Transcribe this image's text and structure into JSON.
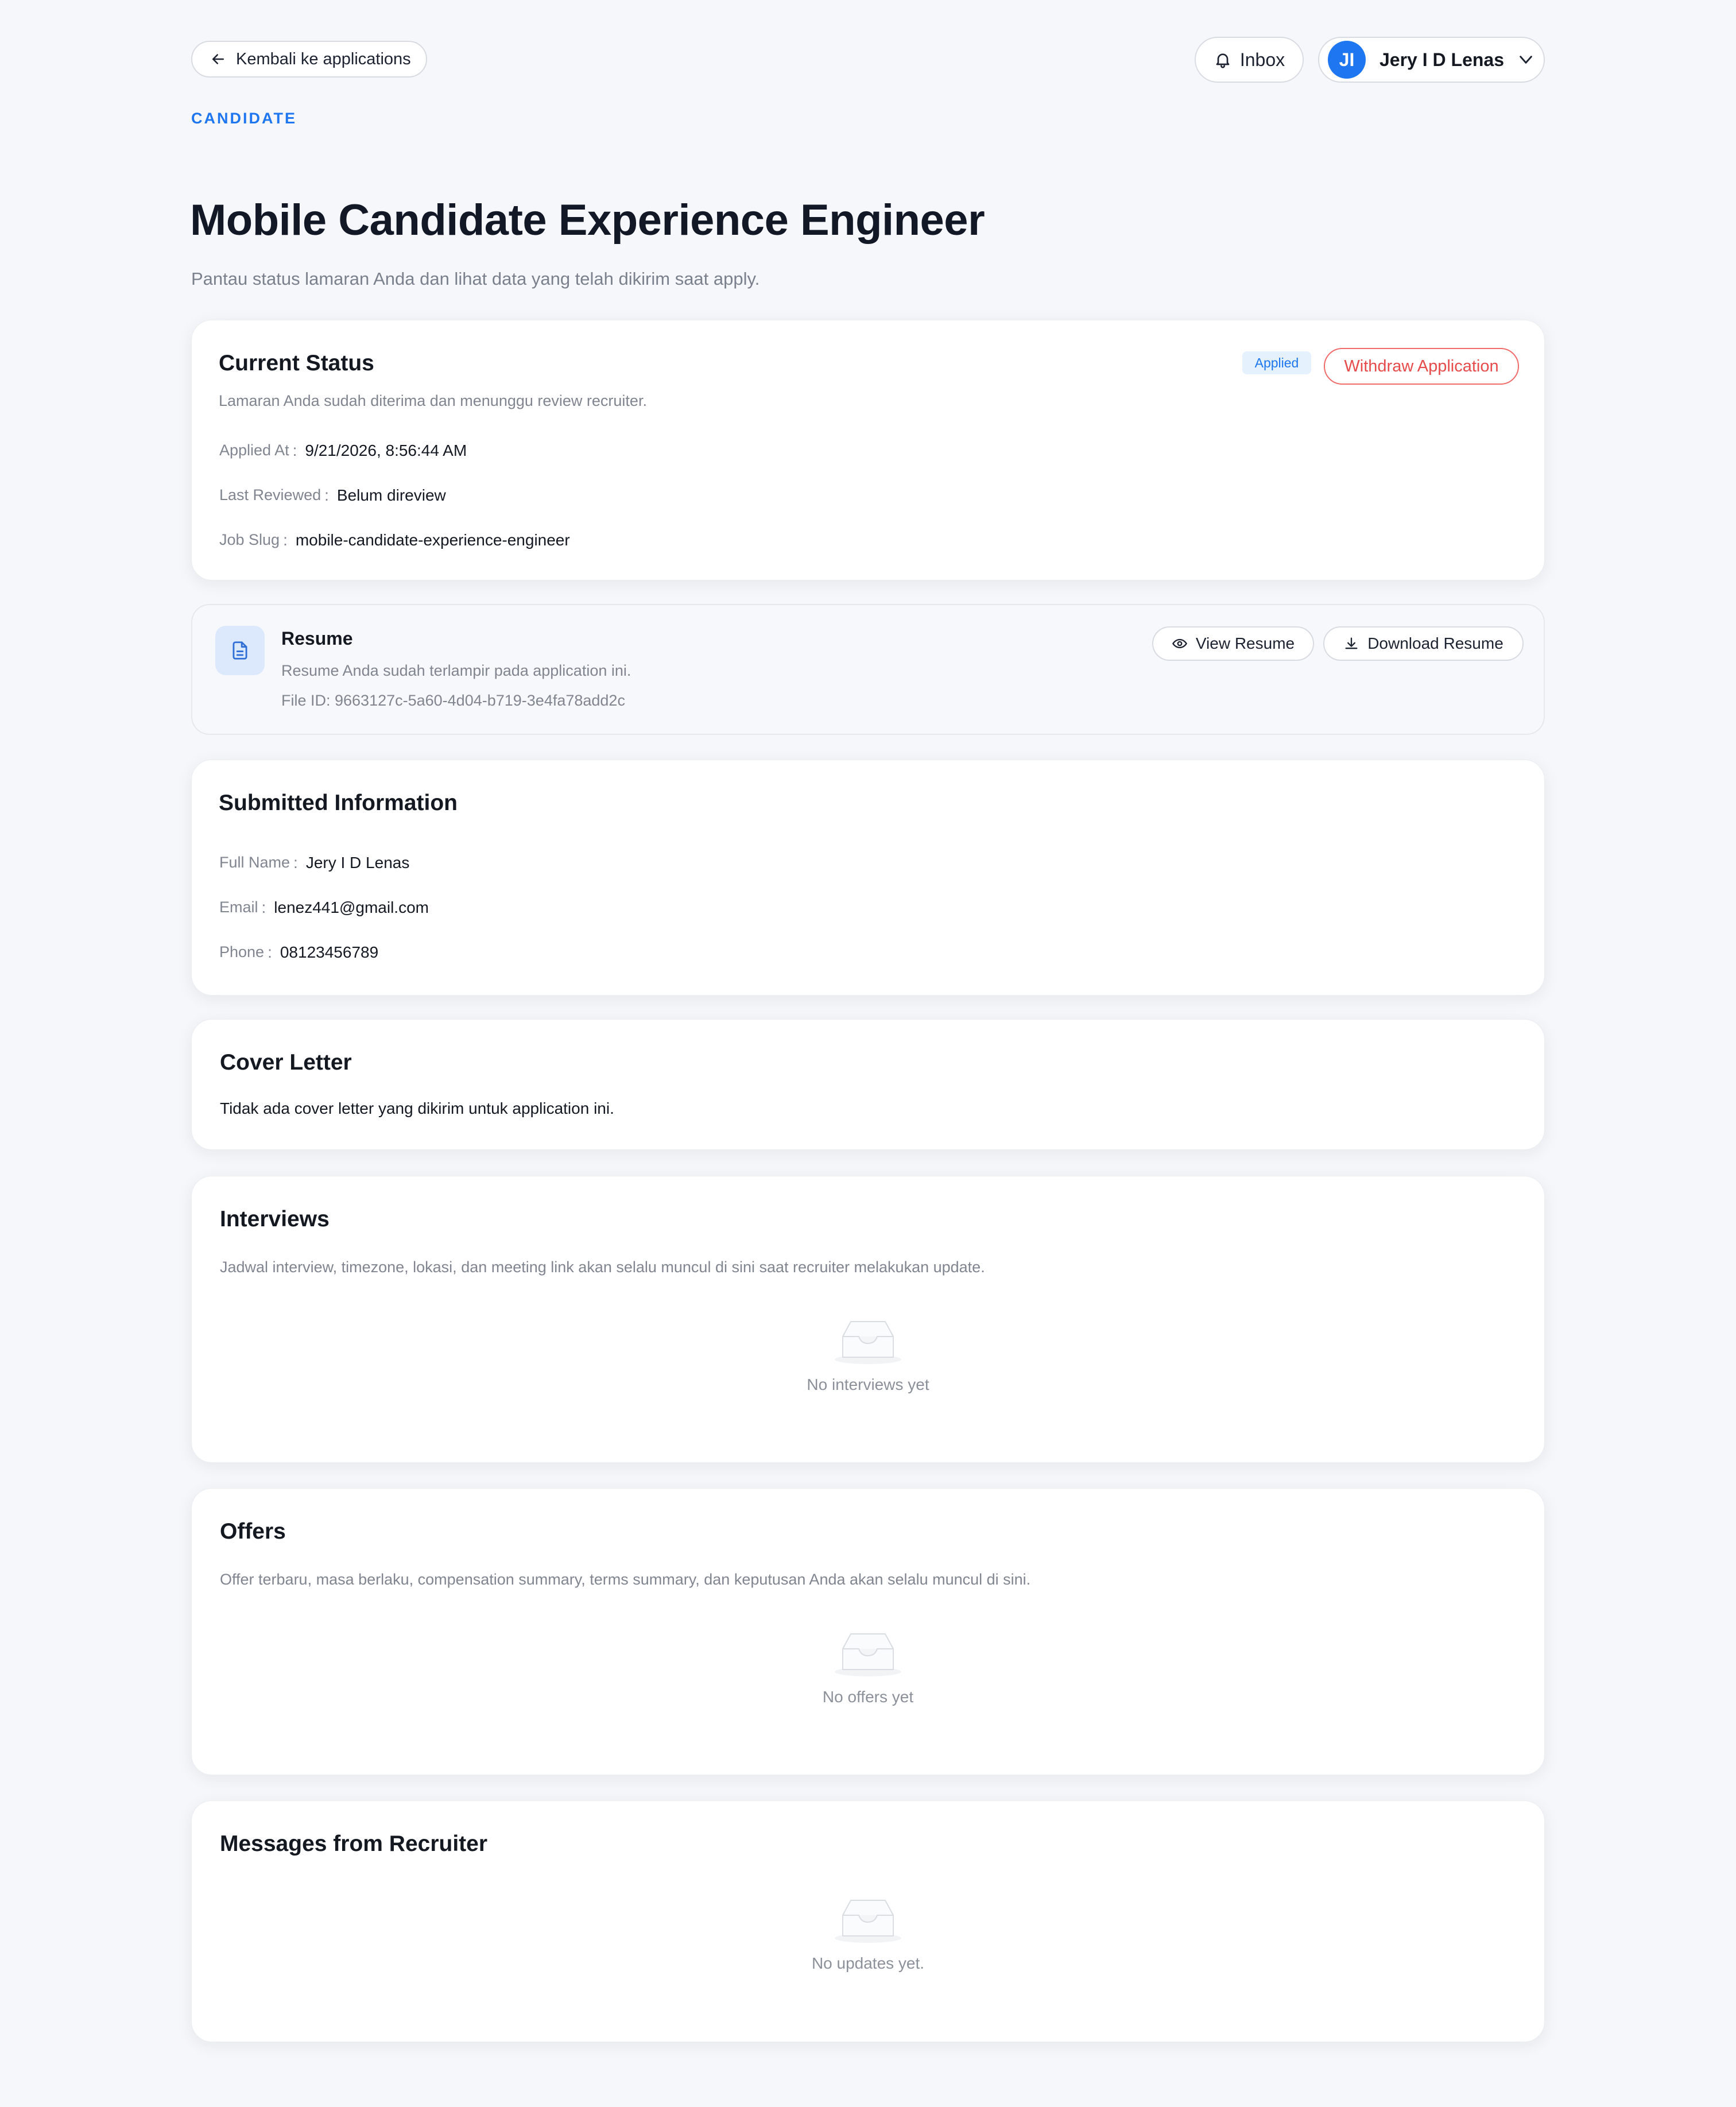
{
  "header": {
    "back_label": "Kembali ke applications",
    "inbox_label": "Inbox",
    "user": {
      "initials": "JI",
      "name": "Jery I D Lenas"
    }
  },
  "page": {
    "eyebrow": "CANDIDATE",
    "title": "Mobile Candidate Experience Engineer",
    "subtitle": "Pantau status lamaran Anda dan lihat data yang telah dikirim saat apply."
  },
  "status_card": {
    "title": "Current Status",
    "badge": "Applied",
    "withdraw_label": "Withdraw Application",
    "description": "Lamaran Anda sudah diterima dan menunggu review recruiter.",
    "fields": [
      {
        "label": "Applied At",
        "value": "9/21/2026, 8:56:44 AM"
      },
      {
        "label": "Last Reviewed",
        "value": "Belum direview"
      },
      {
        "label": "Job Slug",
        "value": "mobile-candidate-experience-engineer"
      }
    ]
  },
  "resume_card": {
    "title": "Resume",
    "description": "Resume Anda sudah terlampir pada application ini.",
    "file_id": "File ID: 9663127c-5a60-4d04-b719-3e4fa78add2c",
    "view_label": "View Resume",
    "download_label": "Download Resume"
  },
  "submitted_card": {
    "title": "Submitted Information",
    "fields": [
      {
        "label": "Full Name",
        "value": "Jery I D Lenas"
      },
      {
        "label": "Email",
        "value": "lenez441@gmail.com"
      },
      {
        "label": "Phone",
        "value": "08123456789"
      }
    ]
  },
  "cover_letter_card": {
    "title": "Cover Letter",
    "body": "Tidak ada cover letter yang dikirim untuk application ini."
  },
  "interviews_card": {
    "title": "Interviews",
    "description": "Jadwal interview, timezone, lokasi, dan meeting link akan selalu muncul di sini saat recruiter melakukan update.",
    "empty_text": "No interviews yet"
  },
  "offers_card": {
    "title": "Offers",
    "description": "Offer terbaru, masa berlaku, compensation summary, terms summary, dan keputusan Anda akan selalu muncul di sini.",
    "empty_text": "No offers yet"
  },
  "messages_card": {
    "title": "Messages from Recruiter",
    "empty_text": "No updates yet."
  },
  "colors": {
    "accent": "#1e76f0",
    "danger": "#e74b4b",
    "badge_bg": "#e5f1fd",
    "background": "#f6f7fa"
  },
  "icons": [
    "arrow-left-icon",
    "bell-icon",
    "chevron-down-icon",
    "file-icon",
    "eye-icon",
    "download-icon",
    "inbox-tray-icon"
  ]
}
